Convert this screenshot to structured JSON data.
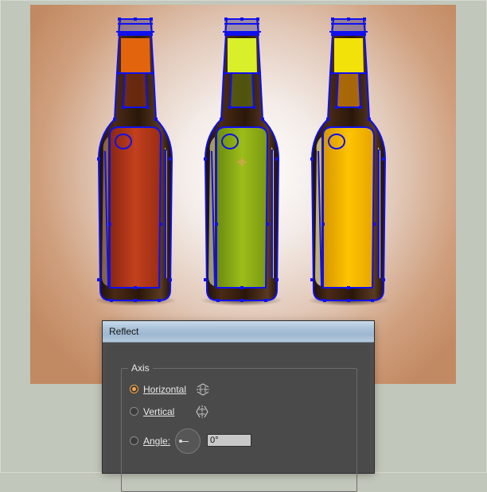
{
  "dialog": {
    "title": "Reflect",
    "axis_group_label": "Axis",
    "options": [
      {
        "label": "Horizontal",
        "selected": true,
        "icon": "reflect-horizontal-icon"
      },
      {
        "label": "Vertical",
        "selected": false,
        "icon": "reflect-vertical-icon"
      },
      {
        "label": "Angle:",
        "selected": false
      }
    ],
    "angle_value": "0°"
  },
  "artwork": {
    "bottles": [
      {
        "liquid_color": "#b83a1c",
        "neck_color": "#e2650e",
        "label": "red-bottle"
      },
      {
        "liquid_color": "#8fb019",
        "neck_color": "#d8ef2a",
        "label": "green-bottle"
      },
      {
        "liquid_color": "#f6b800",
        "neck_color": "#f2e20a",
        "label": "yellow-bottle"
      }
    ],
    "selection_color": "#1010ee",
    "background_color": "#c2c7bb"
  }
}
